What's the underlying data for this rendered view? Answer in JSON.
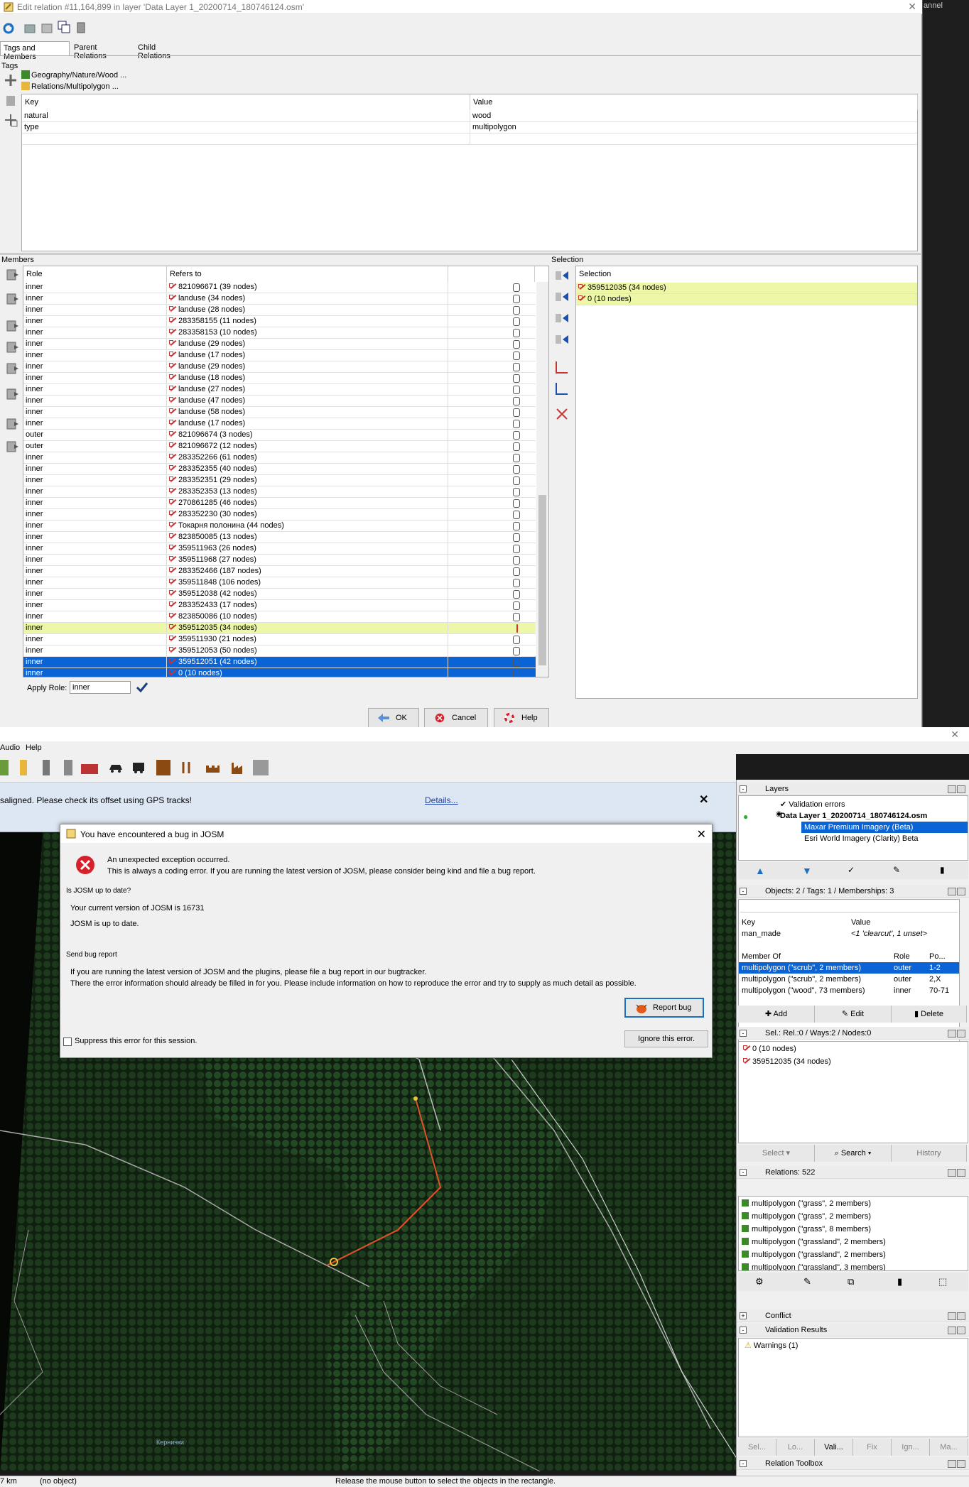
{
  "relation_editor": {
    "title": "Edit relation #11,164,899 in layer 'Data Layer 1_20200714_180746124.osm'",
    "tabs": [
      "Tags and Members",
      "Parent Relations",
      "Child Relations"
    ],
    "tags_label": "Tags",
    "presets": [
      "Geography/Nature/Wood ...",
      "Relations/Multipolygon ..."
    ],
    "tag_headers": {
      "key": "Key",
      "value": "Value"
    },
    "tags": [
      {
        "key": "natural",
        "value": "wood"
      },
      {
        "key": "type",
        "value": "multipolygon"
      }
    ],
    "members_label": "Members",
    "member_headers": {
      "role": "Role",
      "refers_to": "Refers to"
    },
    "members": [
      {
        "role": "inner",
        "ref": "821096671 (39 nodes)"
      },
      {
        "role": "inner",
        "ref": "landuse (34 nodes)"
      },
      {
        "role": "inner",
        "ref": "landuse (28 nodes)"
      },
      {
        "role": "inner",
        "ref": "283358155 (11 nodes)"
      },
      {
        "role": "inner",
        "ref": "283358153 (10 nodes)"
      },
      {
        "role": "inner",
        "ref": "landuse (29 nodes)"
      },
      {
        "role": "inner",
        "ref": "landuse (17 nodes)"
      },
      {
        "role": "inner",
        "ref": "landuse (29 nodes)"
      },
      {
        "role": "inner",
        "ref": "landuse (18 nodes)"
      },
      {
        "role": "inner",
        "ref": "landuse (27 nodes)"
      },
      {
        "role": "inner",
        "ref": "landuse (47 nodes)"
      },
      {
        "role": "inner",
        "ref": "landuse (58 nodes)"
      },
      {
        "role": "inner",
        "ref": "landuse (17 nodes)"
      },
      {
        "role": "outer",
        "ref": "821096674 (3 nodes)"
      },
      {
        "role": "outer",
        "ref": "821096672 (12 nodes)"
      },
      {
        "role": "inner",
        "ref": "283352266 (61 nodes)"
      },
      {
        "role": "inner",
        "ref": "283352355 (40 nodes)"
      },
      {
        "role": "inner",
        "ref": "283352351 (29 nodes)"
      },
      {
        "role": "inner",
        "ref": "283352353 (13 nodes)"
      },
      {
        "role": "inner",
        "ref": "270861285 (46 nodes)"
      },
      {
        "role": "inner",
        "ref": "283352230 (30 nodes)"
      },
      {
        "role": "inner",
        "ref": "Токарня полонина (44 nodes)"
      },
      {
        "role": "inner",
        "ref": "823850085 (13 nodes)"
      },
      {
        "role": "inner",
        "ref": "359511963 (26 nodes)"
      },
      {
        "role": "inner",
        "ref": "359511968 (27 nodes)"
      },
      {
        "role": "inner",
        "ref": "283352466 (187 nodes)"
      },
      {
        "role": "inner",
        "ref": "359511848 (106 nodes)"
      },
      {
        "role": "inner",
        "ref": "359512038 (42 nodes)"
      },
      {
        "role": "inner",
        "ref": "283352433 (17 nodes)"
      },
      {
        "role": "inner",
        "ref": "823850086 (10 nodes)"
      },
      {
        "role": "inner",
        "ref": "359512035 (34 nodes)"
      },
      {
        "role": "inner",
        "ref": "359511930 (21 nodes)"
      },
      {
        "role": "inner",
        "ref": "359512053 (50 nodes)"
      },
      {
        "role": "inner",
        "ref": "359512051 (42 nodes)"
      },
      {
        "role": "inner",
        "ref": "0 (10 nodes)"
      }
    ],
    "selection_label": "Selection",
    "selection_header": "Selection",
    "selection": [
      "359512035 (34 nodes)",
      "0 (10 nodes)"
    ],
    "apply_role_label": "Apply Role:",
    "apply_role_value": "inner",
    "buttons": {
      "ok": "OK",
      "cancel": "Cancel",
      "help": "Help"
    }
  },
  "main": {
    "menu": [
      "Audio",
      "Help"
    ],
    "channel_fragment": "annel",
    "notice": "saligned. Please check its offset using GPS tracks!",
    "notice_link": "Details...",
    "map_place": "Кернички",
    "status": {
      "scale": "7 km",
      "object": "(no object)",
      "message": "Release the mouse button to select the objects in the rectangle."
    }
  },
  "bug_dialog": {
    "title": "You have encountered a bug in JOSM",
    "error_line1": "An unexpected exception occurred.",
    "error_line2": "This is always a coding error. If you are running the latest version of JOSM, please consider being kind and file a bug report.",
    "uptodate_label": "Is JOSM up to date?",
    "version_line": "Your current version of JOSM is 16731",
    "uptodate_line": "JOSM is up to date.",
    "send_label": "Send bug report",
    "send_line1": "If you are running the latest version of JOSM and the plugins, please file a bug report in our bugtracker.",
    "send_line2": "There the error information should already be filled in for you. Please include information on how to reproduce the error and try to supply as much detail as possible.",
    "report_button": "Report bug",
    "suppress_label": "Suppress this error for this session.",
    "ignore_button": "Ignore this error."
  },
  "side_panels": {
    "layers_title": "Layers",
    "layers": [
      "Validation errors",
      "Data Layer 1_20200714_180746124.osm",
      "Maxar Premium Imagery (Beta)",
      "Esri World Imagery (Clarity) Beta"
    ],
    "objects_title": "Objects: 2 / Tags: 1 / Memberships: 3",
    "obj_tag_headers": {
      "key": "Key",
      "value": "Value"
    },
    "obj_tag": {
      "key": "man_made",
      "value": "<1 'clearcut', 1 unset>"
    },
    "membership_headers": {
      "member_of": "Member Of",
      "role": "Role",
      "pos": "Po..."
    },
    "memberships": [
      {
        "member_of": "multipolygon (\"scrub\", 2 members)",
        "role": "outer",
        "pos": "1-2"
      },
      {
        "member_of": "multipolygon (\"scrub\", 2 members)",
        "role": "outer",
        "pos": "2,X"
      },
      {
        "member_of": "multipolygon (\"wood\", 73 members)",
        "role": "inner",
        "pos": "70-71"
      }
    ],
    "obj_buttons": {
      "add": "Add",
      "edit": "Edit",
      "delete": "Delete"
    },
    "selection_title": "Sel.: Rel.:0 / Ways:2 / Nodes:0",
    "selection_items": [
      "0 (10 nodes)",
      "359512035 (34 nodes)"
    ],
    "selection_buttons": {
      "select": "Select",
      "search": "Search",
      "history": "History"
    },
    "relations_title": "Relations: 522",
    "relations": [
      "multipolygon (\"grass\", 2 members)",
      "multipolygon (\"grass\", 2 members)",
      "multipolygon (\"grass\", 8 members)",
      "multipolygon (\"grassland\", 2 members)",
      "multipolygon (\"grassland\", 2 members)",
      "multipolygon (\"grassland\", 3 members)"
    ],
    "conflict_title": "Conflict",
    "validation_title": "Validation Results",
    "warnings": "Warnings (1)",
    "bottom_tabs": [
      "Sel...",
      "Lo...",
      "Vali...",
      "Fix",
      "Ign...",
      "Ma..."
    ],
    "relation_toolbox": "Relation Toolbox"
  },
  "colors": {
    "selected_row": "#0a64d6",
    "highlight_row": "#eef7a8",
    "error_red": "#d8202a"
  }
}
